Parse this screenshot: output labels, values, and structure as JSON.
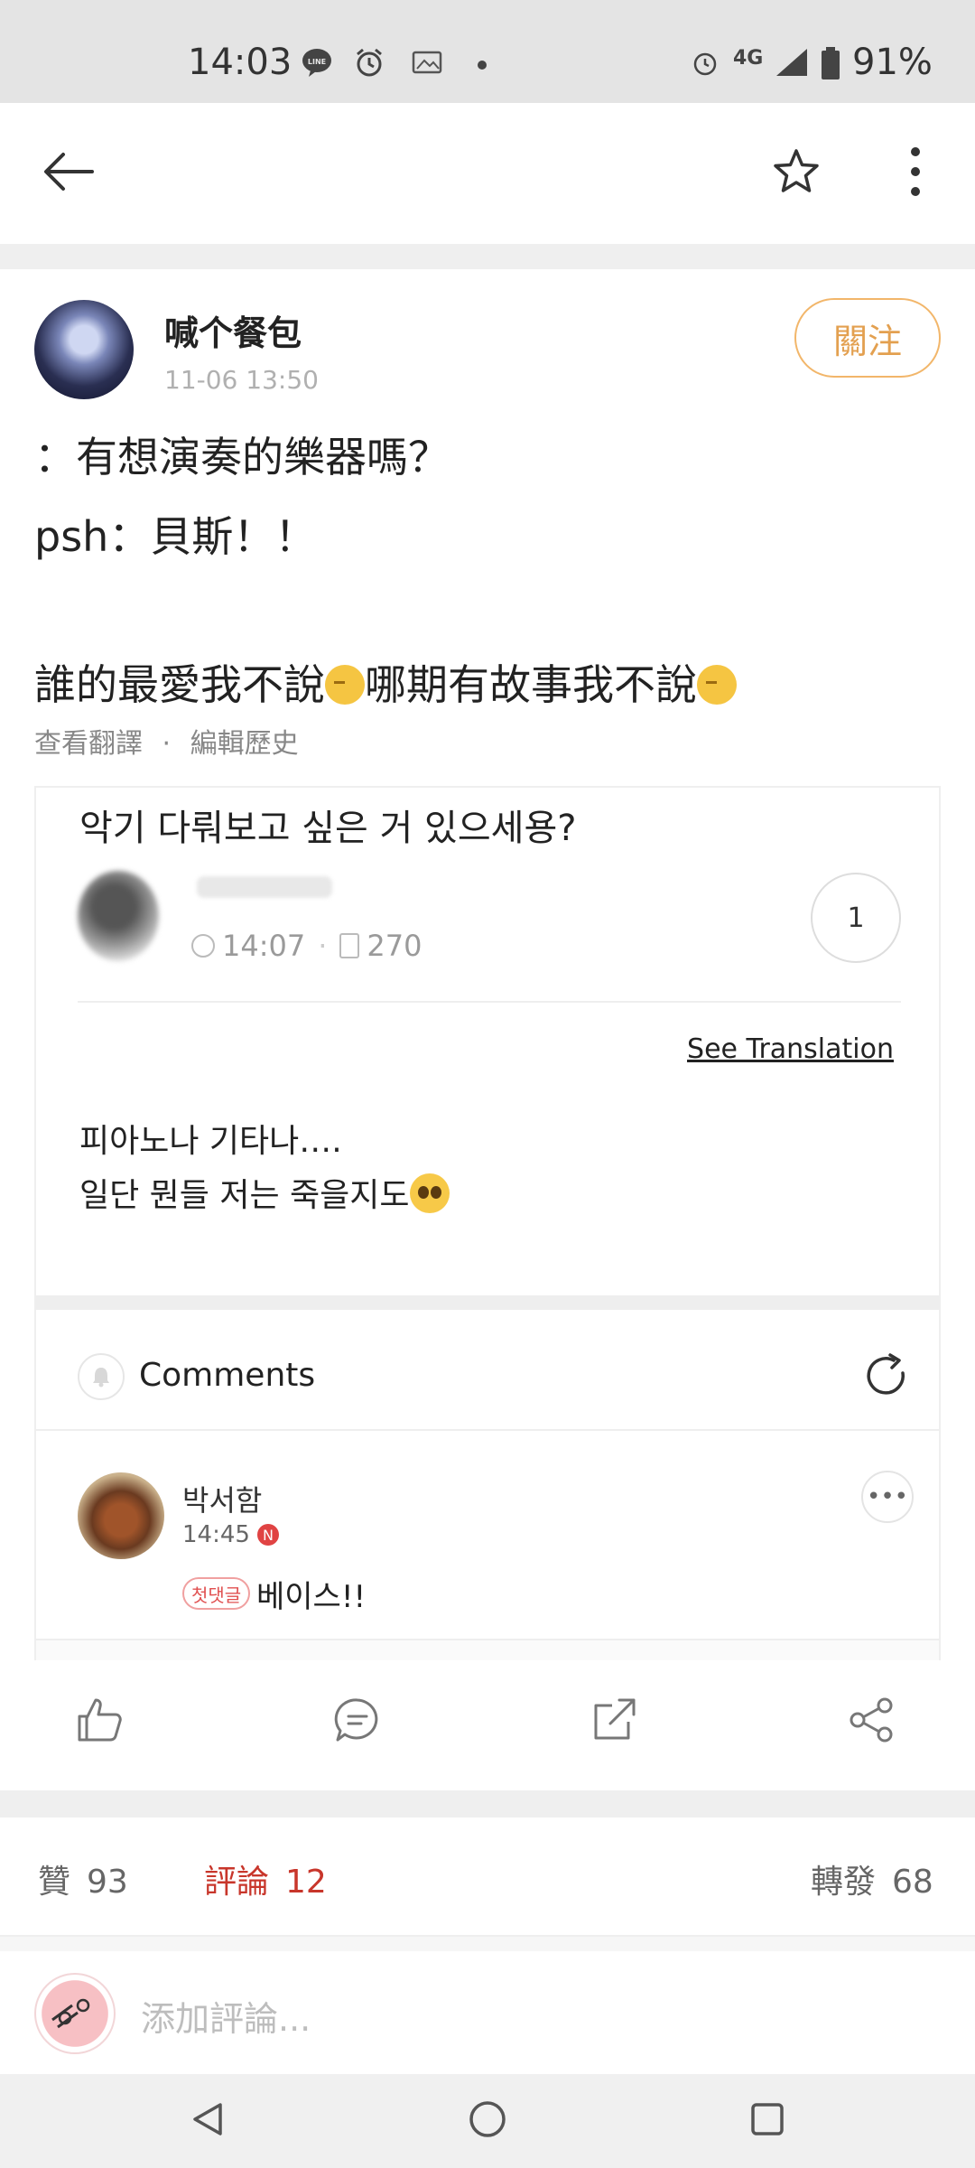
{
  "status_bar": {
    "time": "14:03",
    "network": "4G",
    "battery": "91%"
  },
  "app_bar": {
    "back_icon": "arrow-left-icon",
    "favorite_icon": "star-icon",
    "more_icon": "vertical-dots-icon"
  },
  "post": {
    "author": "喊个餐包",
    "time": "11-06 13:50",
    "follow_label": "關注",
    "lines": [
      "：有想演奏的樂器嗎？",
      "psh：貝斯！！",
      "誰的最愛我不說",
      "哪期有故事我不說"
    ],
    "see_translation": "查看翻譯",
    "separator": "·",
    "edit_history": "編輯歷史"
  },
  "card": {
    "title": "악기 다뤄보고 싶은 거 있으세용?",
    "time": "14:07",
    "views": "270",
    "comment_count": "1",
    "see_translation": "See Translation",
    "body_line_1": "피아노나 기타나….",
    "body_line_2": "일단 뭔들 저는 죽을지도",
    "comments_label": "Comments",
    "comment": {
      "user": "박서함",
      "time": "14:45",
      "badge_n": "N",
      "first_badge": "첫댓글",
      "text": "베이스!!"
    }
  },
  "actions": {
    "like_icon": "thumbs-up-icon",
    "comment_icon": "comment-icon",
    "repost_icon": "repost-icon",
    "share_icon": "share-icon"
  },
  "stats": {
    "likes_label": "贊",
    "likes": "93",
    "comments_label": "評論",
    "comments": "12",
    "reposts_label": "轉發",
    "reposts": "68"
  },
  "comment_input": {
    "placeholder": "添加評論..."
  },
  "colors": {
    "follow_accent": "#e3a050",
    "comments_red": "#c8362b"
  }
}
